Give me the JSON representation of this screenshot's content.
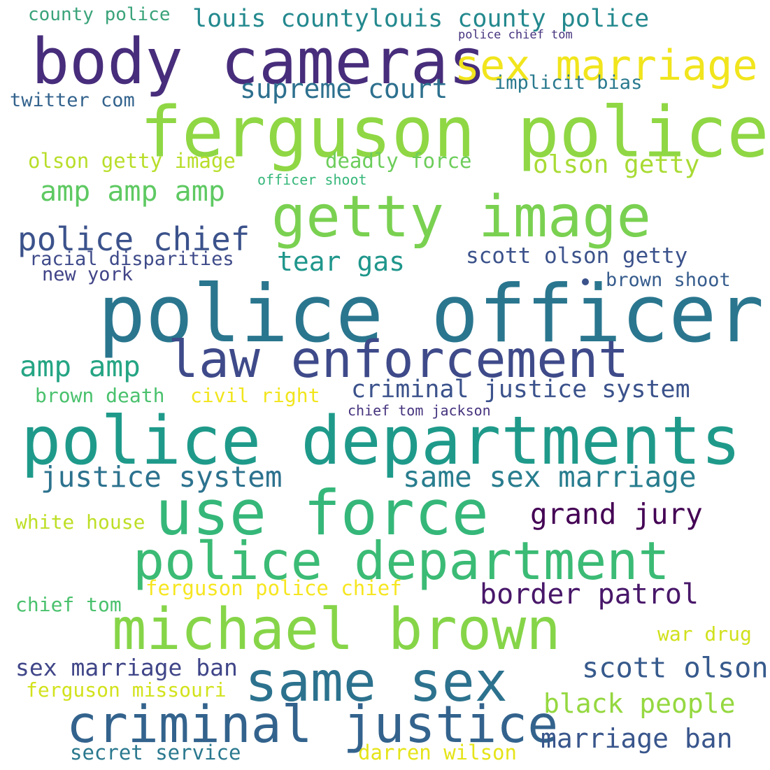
{
  "words": [
    {
      "text": "county police",
      "color": "#3aa37a"
    },
    {
      "text": "louis countylouis county police",
      "color": "#23898e"
    },
    {
      "text": "body cameras",
      "color": "#472d7b"
    },
    {
      "text": "police chief tom",
      "color": "#46337e"
    },
    {
      "text": "sex marriage",
      "color": "#f1e51d"
    },
    {
      "text": "twitter com",
      "color": "#33638d"
    },
    {
      "text": "supreme court",
      "color": "#2d708e"
    },
    {
      "text": "implicit bias",
      "color": "#29798e"
    },
    {
      "text": "ferguson police",
      "color": "#8fd744"
    },
    {
      "text": "olson getty image",
      "color": "#b8de29"
    },
    {
      "text": "deadly force",
      "color": "#6ccd5a"
    },
    {
      "text": "olson getty",
      "color": "#a8db34"
    },
    {
      "text": "officer shoot",
      "color": "#35b779"
    },
    {
      "text": "amp amp amp",
      "color": "#5ec962"
    },
    {
      "text": "getty image",
      "color": "#7ad151"
    },
    {
      "text": "police chief",
      "color": "#3b528b"
    },
    {
      "text": "racial disparities",
      "color": "#3e4a89"
    },
    {
      "text": "new york",
      "color": "#414487"
    },
    {
      "text": "tear gas",
      "color": "#1f968b"
    },
    {
      "text": "scott olson getty",
      "color": "#3b528b"
    },
    {
      "text": "brown shoot",
      "color": "#365c8d"
    },
    {
      "text": "police officer",
      "color": "#2a768e"
    },
    {
      "text": "amp amp",
      "color": "#25a584"
    },
    {
      "text": "law enforcement",
      "color": "#3e4a89"
    },
    {
      "text": "criminal justice system",
      "color": "#3b528b"
    },
    {
      "text": "brown death",
      "color": "#4ac16d"
    },
    {
      "text": "civil right",
      "color": "#f1e51d"
    },
    {
      "text": "chief tom jackson",
      "color": "#46337e"
    },
    {
      "text": "police departments",
      "color": "#1f9a8a"
    },
    {
      "text": "justice system",
      "color": "#2c728e"
    },
    {
      "text": "same sex marriage",
      "color": "#287d8e"
    },
    {
      "text": "use force",
      "color": "#35b779"
    },
    {
      "text": "grand jury",
      "color": "#440154"
    },
    {
      "text": "white house",
      "color": "#bddf26"
    },
    {
      "text": "police department",
      "color": "#3bbb75"
    },
    {
      "text": "ferguson police chief",
      "color": "#f6e620"
    },
    {
      "text": "border patrol",
      "color": "#481769"
    },
    {
      "text": "chief tom",
      "color": "#4ac16d"
    },
    {
      "text": "michael brown",
      "color": "#86d549"
    },
    {
      "text": "war drug",
      "color": "#d0e11c"
    },
    {
      "text": "sex marriage ban",
      "color": "#404688"
    },
    {
      "text": "same sex",
      "color": "#2c728e"
    },
    {
      "text": "scott olson",
      "color": "#375a8c"
    },
    {
      "text": "ferguson missouri",
      "color": "#d2e21b"
    },
    {
      "text": "black people",
      "color": "#95d840"
    },
    {
      "text": "criminal justice",
      "color": "#33638d"
    },
    {
      "text": "marriage ban",
      "color": "#39568c"
    },
    {
      "text": "secret service",
      "color": "#2a788e"
    },
    {
      "text": "darren wilson",
      "color": "#e5e419"
    }
  ]
}
